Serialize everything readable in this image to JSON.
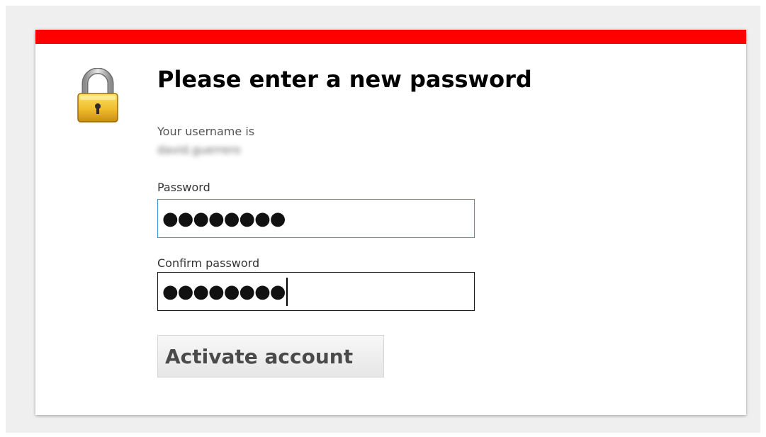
{
  "colors": {
    "accent_bar": "#ff0000",
    "focus_border": "#3c9ad9"
  },
  "icons": {
    "lock": "padlock-icon"
  },
  "form": {
    "title": "Please enter a new password",
    "username_label": "Your username is",
    "username_value": "david.guerrero",
    "password_label": "Password",
    "password_value": "●●●●●●●●",
    "confirm_label": "Confirm password",
    "confirm_value": "●●●●●●●●",
    "submit_label": "Activate account"
  }
}
